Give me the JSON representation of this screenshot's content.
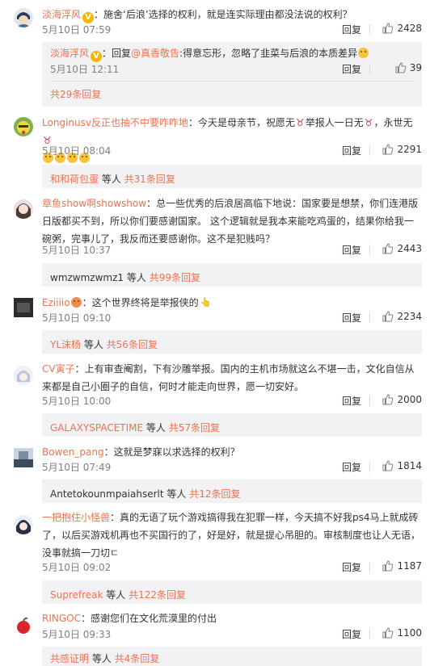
{
  "comments": [
    {
      "user": "淡海浮风",
      "sep": "：",
      "text": "施舍‘后浪’选择的权利，就是连实际理由都没法说的权利？",
      "date": "5月10日 07:59",
      "reply": "回复",
      "likes": "2428",
      "subreply": {
        "user": "淡海浮风",
        "text_prefix": "：回复",
        "mention": "@真香敬告",
        "text": ":得意忘形，忽略了韭菜与后浪的本质差异",
        "date": "5月10日 12:11",
        "reply": "回复",
        "likes": "39"
      },
      "more": "共29条回复"
    },
    {
      "user": "Longinusv反正也抽不中要咋咋地",
      "sep": "：",
      "text": "今天是母亲节，祝愿无",
      "text2": "举报人一日无",
      "text3": "，永世无",
      "date": "5月10日 08:04",
      "reply": "回复",
      "likes": "2291",
      "more_user": "和和荷包蛋",
      "more_mid": " 等人 ",
      "more": "共31条回复"
    },
    {
      "user": "章鱼show啊showshow",
      "sep": "：",
      "text": "总一些优秀的后浪居高临下地说：国家要是想禁，你们连港版日版都买不到，所以你们要感谢国家。 这个逻辑就是我本来能吃鸡蛋的，结果你给我一碗粥，完事儿了，我反而还要感谢你。这不是犯贱吗？",
      "date": "5月10日 10:37",
      "reply": "回复",
      "likes": "2443",
      "more_user": "wmzwmzwmz1",
      "more_mid": " 等人 ",
      "more": "共99条回复"
    },
    {
      "user": "Eziiiio",
      "sep": "：",
      "text": "这个世界终将是举报侠的",
      "date": "5月10日 09:10",
      "reply": "回复",
      "likes": "2234",
      "more_user": "YL沫杨",
      "more_mid": " 等人 ",
      "more": "共56条回复"
    },
    {
      "user": "CV寅子",
      "sep": "：",
      "text": "上有审查阉割，下有沙雕举报。国内的主机市场就这么不堪一击，文化自信从来都是自己小圈子的自信，何时才能走向世界，愿一切安好。",
      "date": "5月10日 10:00",
      "reply": "回复",
      "likes": "2000",
      "more_user": "GALAXYSPACETIME",
      "more_mid": " 等人 ",
      "more": "共57条回复"
    },
    {
      "user": "Bowen_pang",
      "sep": "：",
      "text": "这就是梦寐以求选择的权利？",
      "date": "5月10日 07:49",
      "reply": "回复",
      "likes": "1814",
      "more_user": "Antetokounmpaiahserlt",
      "more_mid": " 等人 ",
      "more": "共12条回复"
    },
    {
      "user": "一把抱住小怪兽",
      "sep": "：",
      "text": "真的无语了玩个游戏搞得我在犯罪一样，今天搞不好我ps4马上就成砖了，以后买游戏机再也不买国行的了，好是好，就是提心吊胆的。审核制度也让人无语，没事就搞一刀切ㄷ",
      "date": "5月10日 09:02",
      "reply": "回复",
      "likes": "1187",
      "more_user": "Suprefreak",
      "more_mid": " 等人 ",
      "more": "共122条回复"
    },
    {
      "user": "RINGOC",
      "sep": "：",
      "text": "感谢您们在文化荒漠里的付出",
      "date": "5月10日 09:33",
      "reply": "回复",
      "likes": "1100",
      "more_user": "共感证明",
      "more_mid": " 等人 ",
      "more": "共4条回复"
    }
  ],
  "colors": {
    "link": "#eb7350",
    "text": "#333333",
    "meta": "#808080",
    "box_bg": "#f2f2f5",
    "verified": "#f7b500"
  }
}
